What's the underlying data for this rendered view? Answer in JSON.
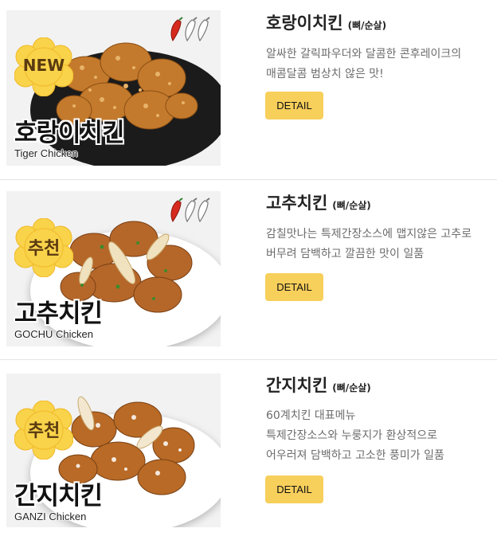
{
  "menu": {
    "items": [
      {
        "name": "호랑이치킨",
        "name_suffix": "(뼈/순살)",
        "description_lines": [
          "알싸한 갈릭파우더와 달콤한 콘후레이크의",
          "매콤달콤 범상치 않은 맛!"
        ],
        "detail_label": "DETAIL",
        "photo_title": "호랑이치킨",
        "photo_subtitle": "Tiger Chicken",
        "badge_text": "NEW",
        "spice_icons": [
          "red-pepper-icon",
          "white-pepper-icon",
          "white-pepper-icon"
        ]
      },
      {
        "name": "고추치킨",
        "name_suffix": "(뼈/순살)",
        "description_lines": [
          "감칠맛나는 특제간장소스에 맵지않은 고추로",
          "버무려 담백하고 깔끔한 맛이 일품"
        ],
        "detail_label": "DETAIL",
        "photo_title": "고추치킨",
        "photo_subtitle": "GOCHU Chicken",
        "badge_text": "추천",
        "spice_icons": [
          "red-pepper-icon",
          "white-pepper-icon",
          "white-pepper-icon"
        ]
      },
      {
        "name": "간지치킨",
        "name_suffix": "(뼈/순살)",
        "description_lines": [
          "60계치킨 대표메뉴",
          "특제간장소스와 누룽지가 환상적으로",
          "어우러져 담백하고 고소한 풍미가 일품"
        ],
        "detail_label": "DETAIL",
        "photo_title": "간지치킨",
        "photo_subtitle": "GANZI Chicken",
        "badge_text": "추천",
        "spice_icons": []
      }
    ]
  },
  "colors": {
    "detail_button": "#f7cf5b",
    "badge": "#f9d34a",
    "pepper_red": "#d62a1e",
    "divider": "#e4e4e4"
  }
}
